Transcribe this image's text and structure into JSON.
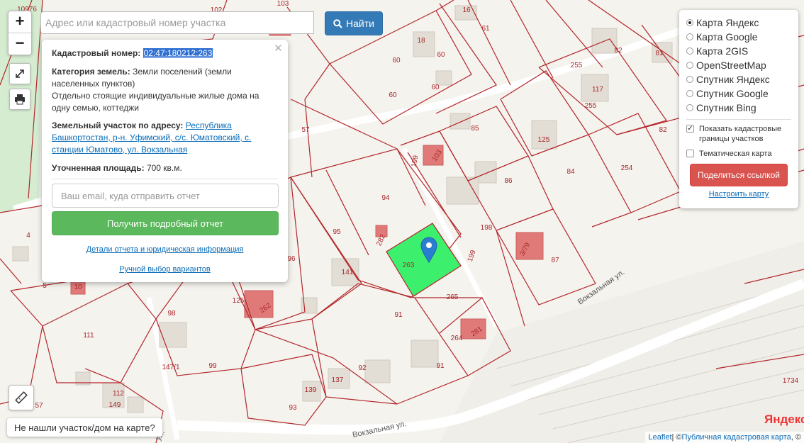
{
  "search": {
    "placeholder": "Адрес или кадастровый номер участка",
    "button_label": "Найти"
  },
  "zoom": {
    "in": "+",
    "out": "−"
  },
  "popup": {
    "cad_label": "Кадастровый номер:",
    "cad_number": "02:47:180212:263",
    "category_label": "Категория земель:",
    "category_value": "Земли поселений (земли населенных пунктов)",
    "usage": "Отдельно стоящие индивидуальные жилые дома на одну семью, коттеджи",
    "address_label": "Земельный участок по адресу:",
    "address_value": "Республика Башкортостан, р-н. Уфимский, с/с. Юматовский, с. станции Юматово, ул. Вокзальная",
    "area_label": "Уточненная площадь:",
    "area_value": "700 кв.м.",
    "email_placeholder": "Ваш email, куда отправить отчет",
    "report_button": "Получить подробный отчет",
    "details_link": "Детали отчета и юридическая информация",
    "manual_link": "Ручной выбор вариантов"
  },
  "layers": {
    "options": [
      {
        "label": "Карта Яндекс",
        "selected": true
      },
      {
        "label": "Карта Google",
        "selected": false
      },
      {
        "label": "Карта 2GIS",
        "selected": false
      },
      {
        "label": "OpenStreetMap",
        "selected": false
      },
      {
        "label": "Спутник Яндекс",
        "selected": false
      },
      {
        "label": "Спутник Google",
        "selected": false
      },
      {
        "label": "Спутник Bing",
        "selected": false
      }
    ],
    "cadastral_label": "Показать кадастровые границы участков",
    "cadastral_checked": true,
    "thematic_label": "Тематическая карта",
    "thematic_checked": false,
    "share_button": "Поделиться ссылкой",
    "setup_link": "Настроить карту"
  },
  "bottom": {
    "not_found": "Не нашли участок/дом на карте?",
    "attrib_leaflet": "Leaflet",
    "attrib_sep": " | © ",
    "attrib_pkk": "Публичная кадастровая карта",
    "attrib_tail": ", ©",
    "yandex": "Яндекс"
  },
  "map": {
    "colors": {
      "boundary": "#b3262b",
      "selected": "#3cf06e",
      "marker": "#2a7dd1",
      "building": "#e3ded5",
      "red_building": "#e07a78"
    },
    "plot_numbers": [
      "10976",
      "102",
      "103",
      "16",
      "61",
      "18",
      "60",
      "60",
      "60",
      "60",
      "82",
      "81",
      "255",
      "117",
      "255",
      "57",
      "85",
      "103",
      "199",
      "125",
      "82",
      "84",
      "254",
      "86",
      "94",
      "198",
      "95",
      "282",
      "263",
      "199",
      "3/79",
      "87",
      "96",
      "141",
      "265",
      "125",
      "262",
      "98",
      "91",
      "264",
      "281",
      "111",
      "147/1",
      "99",
      "137",
      "92",
      "91",
      "139",
      "112",
      "149",
      "93",
      "57",
      "4",
      "5",
      "10",
      "1734"
    ],
    "street_labels": [
      "Вокзальная ул.",
      "Вокзальная ул."
    ]
  }
}
